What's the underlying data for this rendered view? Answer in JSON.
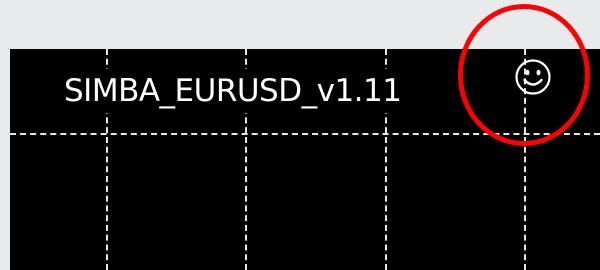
{
  "chart": {
    "expert_advisor_name": "SIMBA_EURUSD_v1.11",
    "expert_status_icon": "smiley-face-icon"
  },
  "colors": {
    "chart_background": "#000000",
    "grid_lines": "#ffffff",
    "label_text": "#ffffff",
    "annotation_circle": "#ff0000",
    "page_background": "#e9eaec"
  },
  "annotation": {
    "shape": "circle",
    "target": "smiley-face-icon"
  }
}
